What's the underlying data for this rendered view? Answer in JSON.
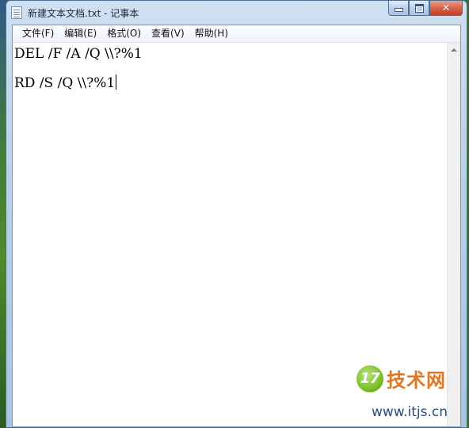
{
  "window": {
    "title": "新建文本文档.txt - 记事本",
    "close_glyph": "✕"
  },
  "menu": [
    {
      "label": "文件(F)"
    },
    {
      "label": "编辑(E)"
    },
    {
      "label": "格式(O)"
    },
    {
      "label": "查看(V)"
    },
    {
      "label": "帮助(H)"
    }
  ],
  "editor": {
    "lines": [
      "DEL /F /A /Q \\\\?%1",
      "RD /S /Q \\\\?%1"
    ]
  },
  "watermark": {
    "logo_text": "17",
    "brand": "技术网",
    "url": "www.itjs.cn"
  },
  "icons": {
    "app": "notepad-icon",
    "minimize": "minimize-icon",
    "maximize": "maximize-icon",
    "close": "close-icon",
    "scroll_up": "scroll-up-arrow-icon"
  }
}
